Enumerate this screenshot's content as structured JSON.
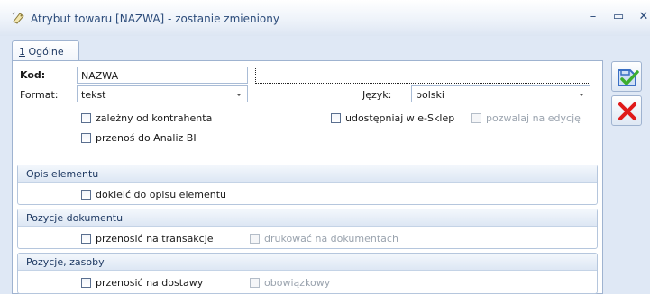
{
  "window": {
    "title": "Atrybut towaru [NAZWA] - zostanie zmieniony",
    "minimize_glyph": "–",
    "maximize_glyph": "▭",
    "close_glyph": "✕"
  },
  "tabs": [
    {
      "number": "1",
      "label": "Ogólne",
      "active": true
    }
  ],
  "form": {
    "kod_label": "Kod:",
    "kod_value": "NAZWA",
    "kod_desc_value": "",
    "format_label": "Format:",
    "format_value": "tekst",
    "jezyk_label": "Język:",
    "jezyk_value": "polski"
  },
  "checkboxes": {
    "zalezny": {
      "label": "zależny od kontrahenta",
      "checked": false,
      "disabled": false
    },
    "przenos_bi": {
      "label": "przenoś do Analiz BI",
      "checked": false,
      "disabled": false
    },
    "eskelp": {
      "label": "udostępniaj w e-Sklep",
      "checked": false,
      "disabled": false
    },
    "edycja": {
      "label": "pozwalaj na edycję",
      "checked": false,
      "disabled": true
    }
  },
  "sections": {
    "opis": {
      "title": "Opis elementu",
      "dokleic": {
        "label": "dokleić do opisu elementu",
        "checked": false,
        "disabled": false
      }
    },
    "pozycje_dok": {
      "title": "Pozycje dokumentu",
      "transakcje": {
        "label": "przenosić na transakcje",
        "checked": false,
        "disabled": false
      },
      "drukowac": {
        "label": "drukować na dokumentach",
        "checked": false,
        "disabled": true
      }
    },
    "pozycje_zas": {
      "title": "Pozycje, zasoby",
      "dostawy": {
        "label": "przenosić na dostawy",
        "checked": false,
        "disabled": false
      },
      "obowiazkowy": {
        "label": "obowiązkowy",
        "checked": false,
        "disabled": true
      }
    }
  },
  "actions": {
    "save_icon": "save-check-icon",
    "cancel_icon": "red-x-icon"
  },
  "colors": {
    "accent": "#2b4b7a",
    "border": "#9fb3d0",
    "cancel_red": "#e01a1a",
    "save_blue": "#3a6fc4",
    "save_green": "#3cae2e"
  }
}
